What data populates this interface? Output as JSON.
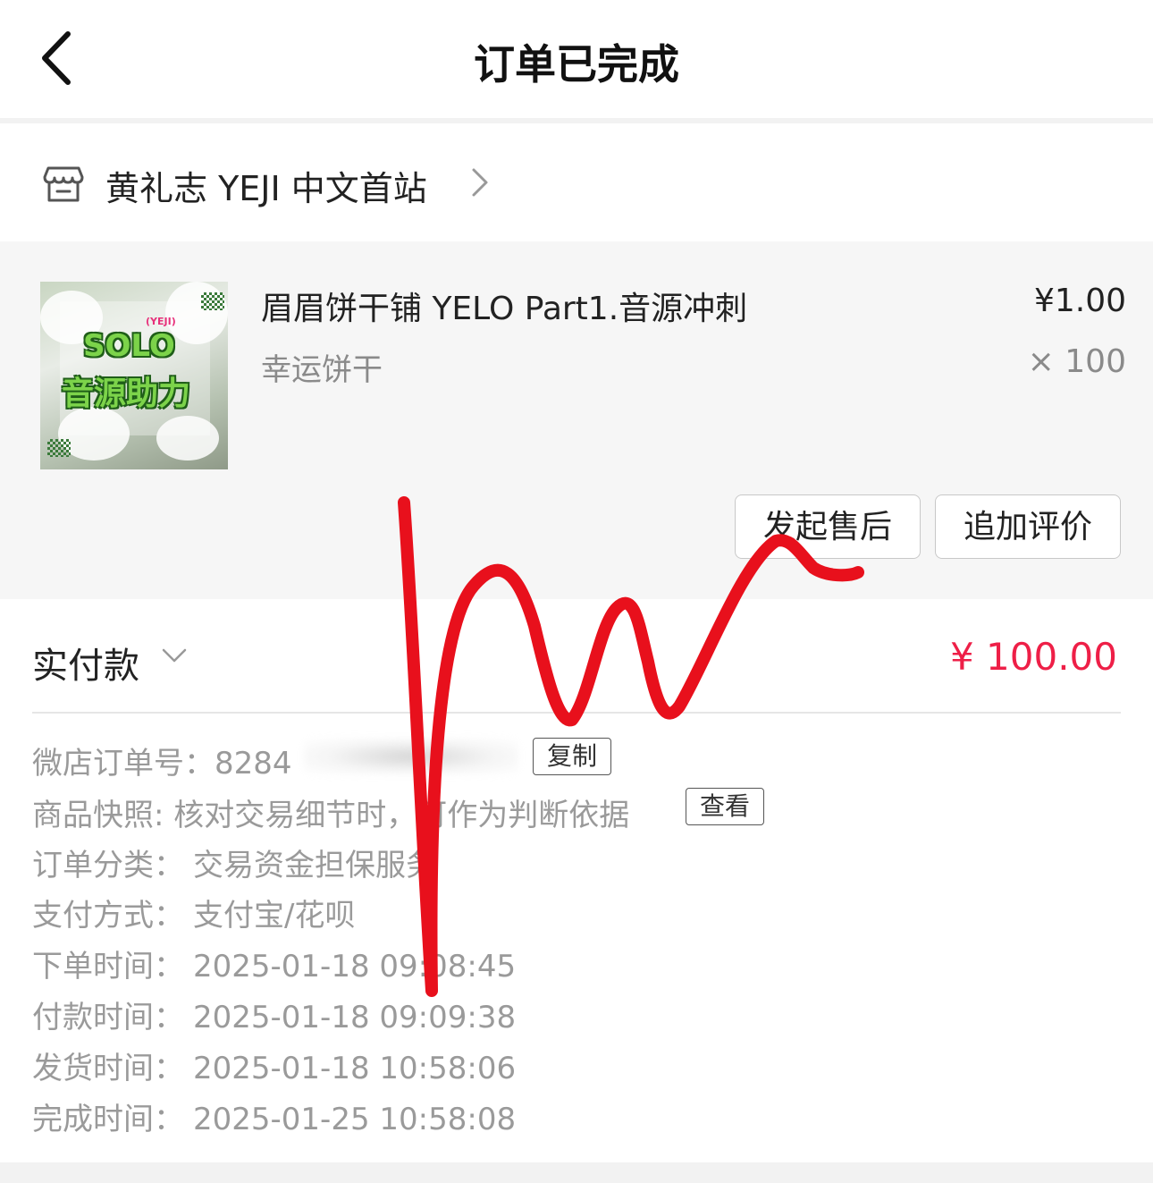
{
  "nav": {
    "title": "订单已完成",
    "back_icon": "chevron-left-icon"
  },
  "shop": {
    "icon": "shop-icon",
    "name": "黄礼志 YEJI 中文首站",
    "arrow_icon": "chevron-right-icon"
  },
  "item": {
    "image_text": {
      "tag": "(YEJI)",
      "line1": "SOLO",
      "line2": "音源助力"
    },
    "title": "眉眉饼干铺 YELO Part1.音源冲刺",
    "spec": "幸运饼干",
    "price": "¥1.00",
    "quantity": "× 100"
  },
  "actions": {
    "after_sale": "发起售后",
    "add_review": "追加评价"
  },
  "payment": {
    "label": "实付款",
    "amount": "¥ 100.00",
    "amount_color": "#ee1f47"
  },
  "details": {
    "order_no_label": "微店订单号：",
    "order_no_value": "8284",
    "copy_label": "复制",
    "snapshot_text": "商品快照: 核对交易细节时，可作为判断依据",
    "view_label": "查看",
    "rows": [
      {
        "label": "订单分类：",
        "value": "交易资金担保服务"
      },
      {
        "label": "支付方式：",
        "value": "支付宝/花呗"
      },
      {
        "label": "下单时间：",
        "value": "2025-01-18 09:08:45"
      },
      {
        "label": "付款时间：",
        "value": "2025-01-18 09:09:38"
      },
      {
        "label": "发货时间：",
        "value": "2025-01-18 10:58:06"
      },
      {
        "label": "完成时间：",
        "value": "2025-01-25 10:58:08"
      }
    ]
  }
}
